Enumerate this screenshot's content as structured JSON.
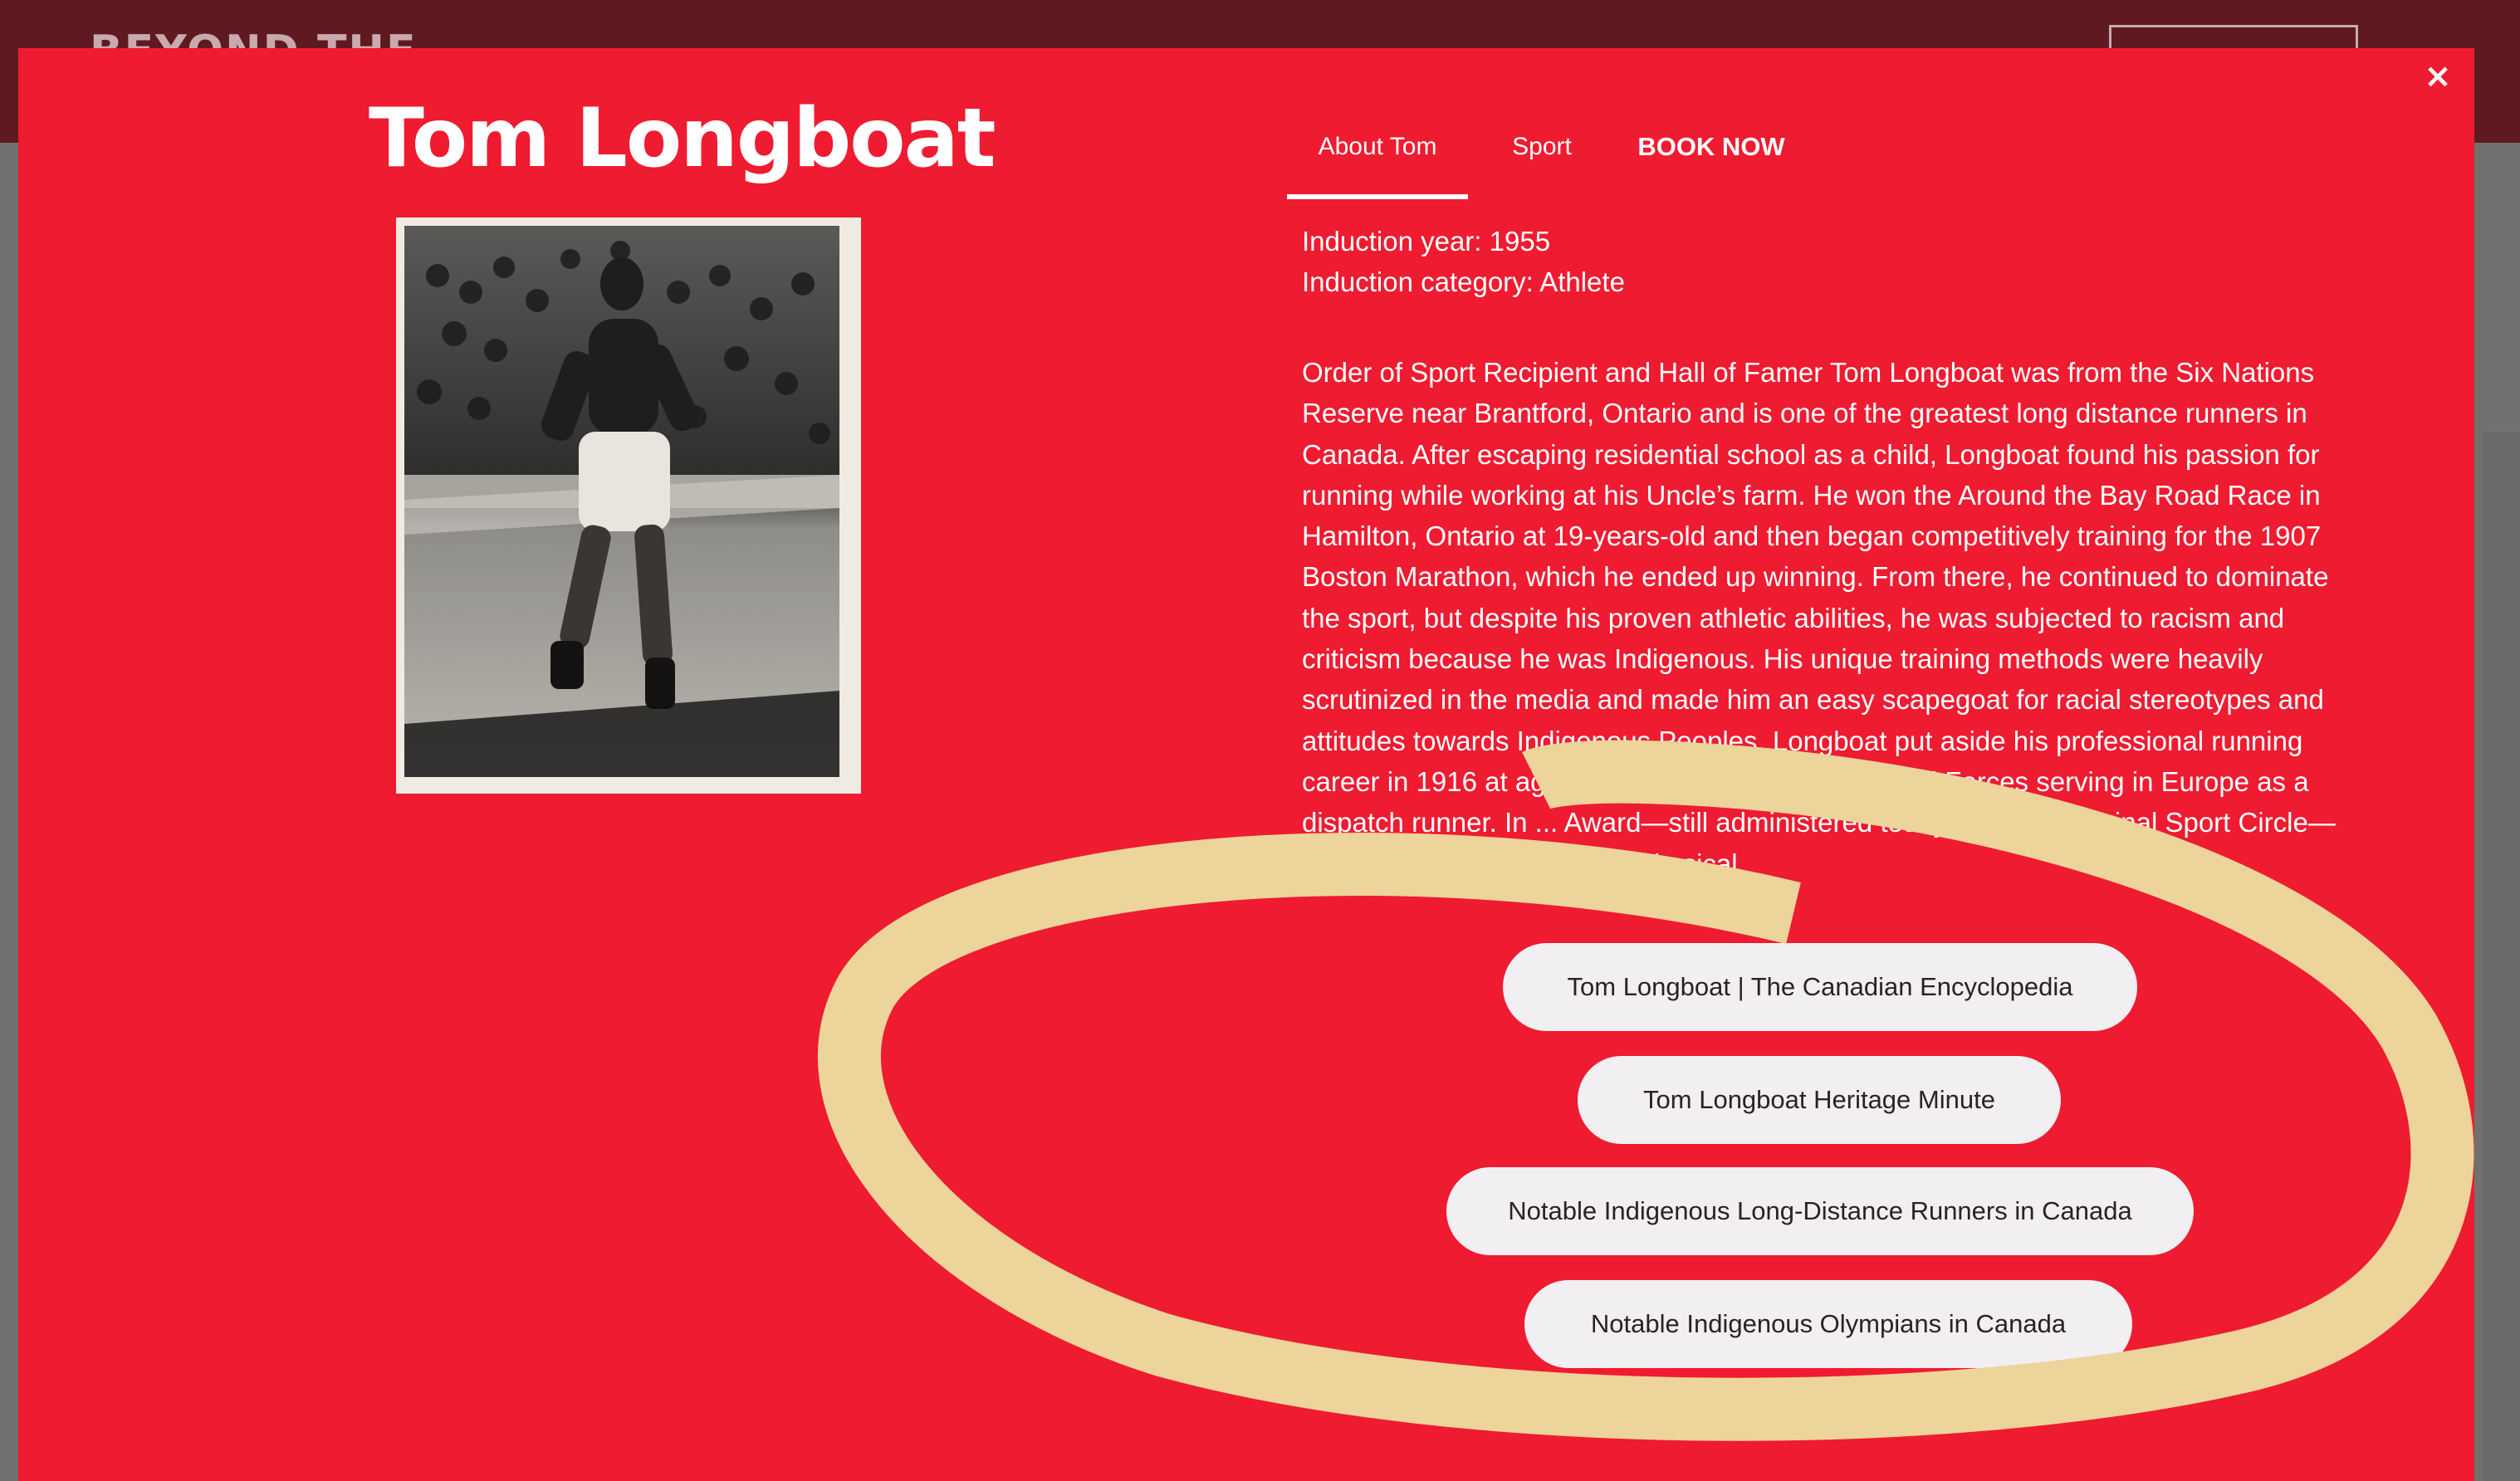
{
  "site": {
    "logo_text": "BEYOND THE WIN"
  },
  "modal": {
    "close_label": "×",
    "name": "Tom Longboat",
    "photo_alt": "Black and white photo of Tom Longboat running",
    "tabs": [
      {
        "label": "About Tom",
        "active": true
      },
      {
        "label": "Sport",
        "active": false
      },
      {
        "label": "BOOK NOW",
        "active": false
      }
    ],
    "induction_year": "Induction year: 1955",
    "induction_category": "Induction category: Athlete",
    "bio": "Order of Sport Recipient and Hall of Famer Tom Longboat was from the Six Nations Reserve near Brantford, Ontario and is one of the greatest long distance runners in Canada. After escaping residential school as a child, Longboat found his passion for running while working at his Uncle’s farm. He won the Around the Bay Road Race in Hamilton, Ontario at 19-years-old and then began competitively training for the 1907 Boston Marathon, which he ended up winning. From there, he continued to dominate the sport, but despite his proven athletic abilities, he was subjected to racism and criticism because he was Indigenous. His unique training methods were heavily scrutinized in the media and made him an easy scapegoat for racial stereotypes and attitudes towards Indigenous Peoples. Longboat put aside his professional running career in 1916 at age 29 to join the Canadian Armed Forces serving in Europe as a dispatch runner. In ... Award—still administered today by the Aboriginal Sport Circle—was created ... in sport and physical",
    "links": [
      "Tom Longboat | The Canadian Encyclopedia",
      "Tom Longboat Heritage Minute",
      "Notable Indigenous Long-Distance Runners in Canada",
      "Notable Indigenous Olympians in Canada"
    ]
  },
  "colors": {
    "modal_bg": "#ef1b30",
    "header_bg": "#5e1a20",
    "button_bg": "#f2eff2",
    "annotation": "#ecd49a"
  }
}
